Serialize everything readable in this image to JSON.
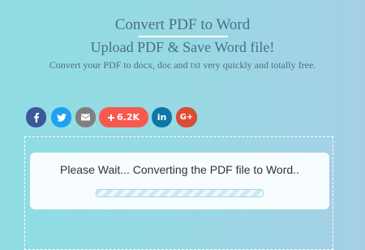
{
  "header": {
    "title": "Convert PDF to Word",
    "subtitle": "Upload PDF & Save Word file!",
    "description": "Convert your PDF to docx, doc and txt very quickly and totally free."
  },
  "share": {
    "facebook_icon": "facebook-icon",
    "twitter_icon": "twitter-icon",
    "email_icon": "email-icon",
    "count_label": "6.2K",
    "linkedin_label": "in",
    "googleplus_label": "G+",
    "colors": {
      "facebook": "#3b5998",
      "twitter": "#1da1f2",
      "email": "#7f7f7f",
      "count": "#f65a4d",
      "linkedin": "#0e76a8",
      "googleplus": "#dc4a38"
    }
  },
  "converter": {
    "status": "Please Wait... Converting the PDF file to Word..",
    "progress_percent": 100
  }
}
